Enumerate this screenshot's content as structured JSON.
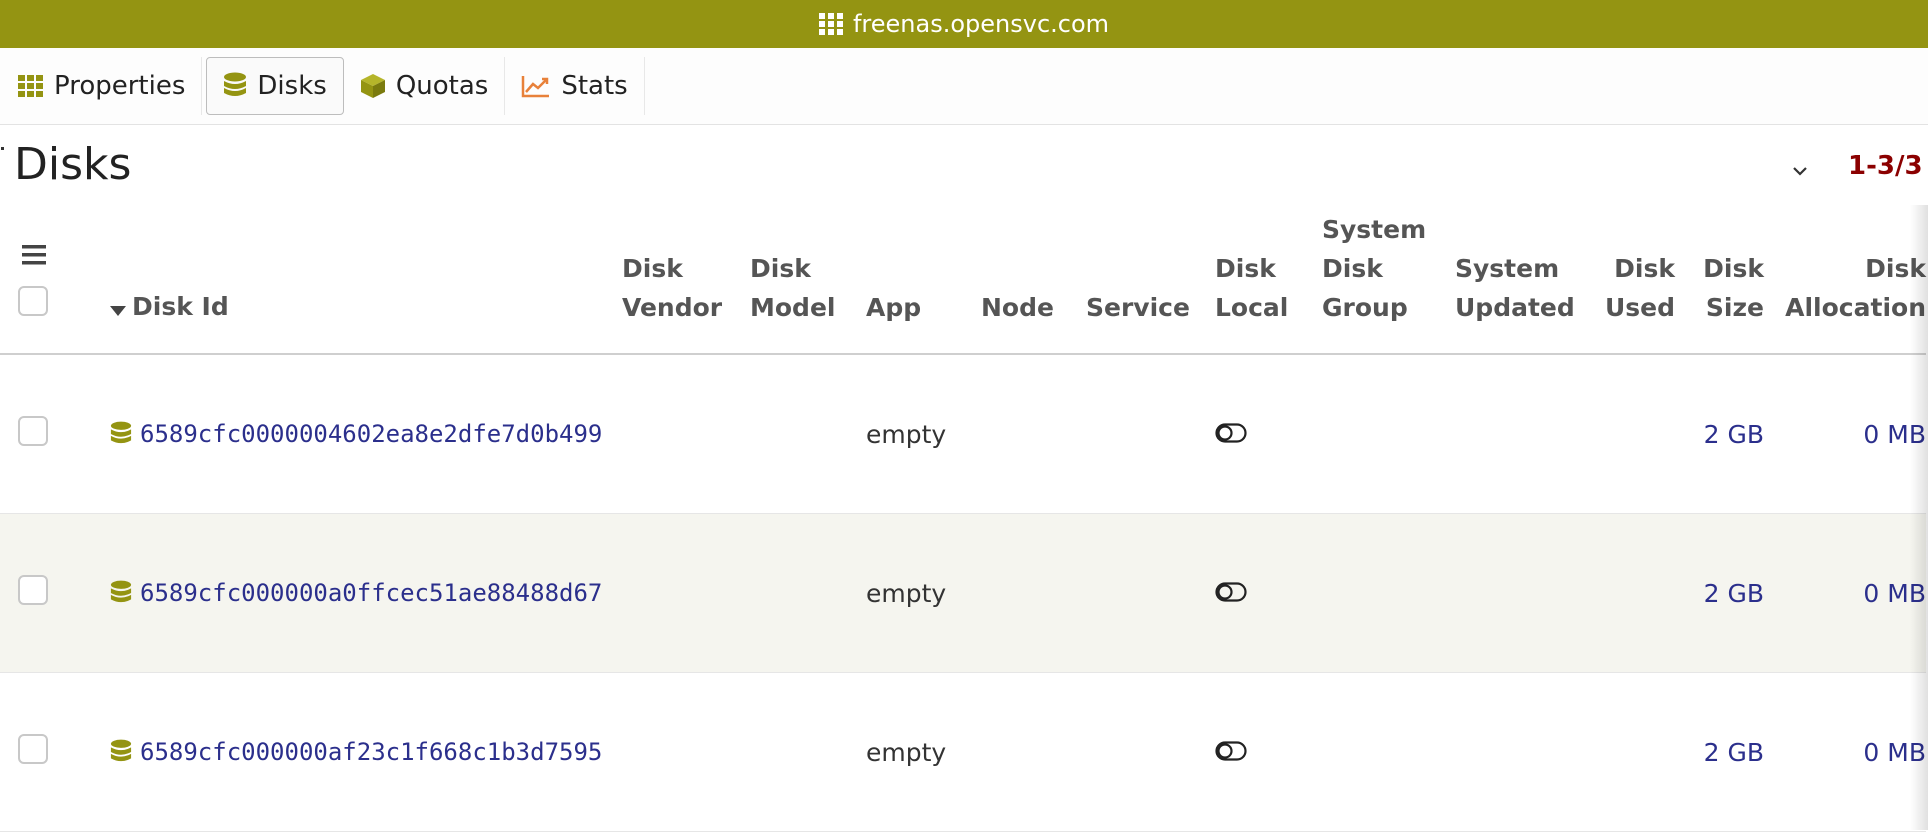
{
  "window": {
    "title": "freenas.opensvc.com"
  },
  "tabs": [
    {
      "label": "Properties",
      "icon": "grid-icon",
      "active": false
    },
    {
      "label": "Disks",
      "icon": "database-icon",
      "active": true
    },
    {
      "label": "Quotas",
      "icon": "box-icon",
      "active": false
    },
    {
      "label": "Stats",
      "icon": "chart-line-icon",
      "active": false
    }
  ],
  "page": {
    "title": "Disks",
    "pager": "1-3/3"
  },
  "table": {
    "columns": {
      "disk_id": "Disk Id",
      "disk_vendor": [
        "Disk",
        "Vendor"
      ],
      "disk_model": [
        "Disk",
        "Model"
      ],
      "app": "App",
      "node": "Node",
      "service": "Service",
      "disk_local": [
        "Disk",
        "Local"
      ],
      "system_disk_group": [
        "System",
        "Disk",
        "Group"
      ],
      "system_updated": [
        "System",
        "Updated"
      ],
      "disk_used": [
        "Disk",
        "Used"
      ],
      "disk_size": [
        "Disk",
        "Size"
      ],
      "disk_allocation": [
        "Disk",
        "Allocation"
      ]
    },
    "rows": [
      {
        "disk_id": "6589cfc0000004602ea8e2dfe7d0b499",
        "app": "empty",
        "disk_size": "2 GB",
        "disk_allocation": "0 MB"
      },
      {
        "disk_id": "6589cfc000000a0ffcec51ae88488d67",
        "app": "empty",
        "disk_size": "2 GB",
        "disk_allocation": "0 MB"
      },
      {
        "disk_id": "6589cfc000000af23c1f668c1b3d7595",
        "app": "empty",
        "disk_size": "2 GB",
        "disk_allocation": "0 MB"
      }
    ]
  },
  "colors": {
    "brand": "#949412",
    "link": "#2b2f8c",
    "pager": "#8b0000"
  }
}
